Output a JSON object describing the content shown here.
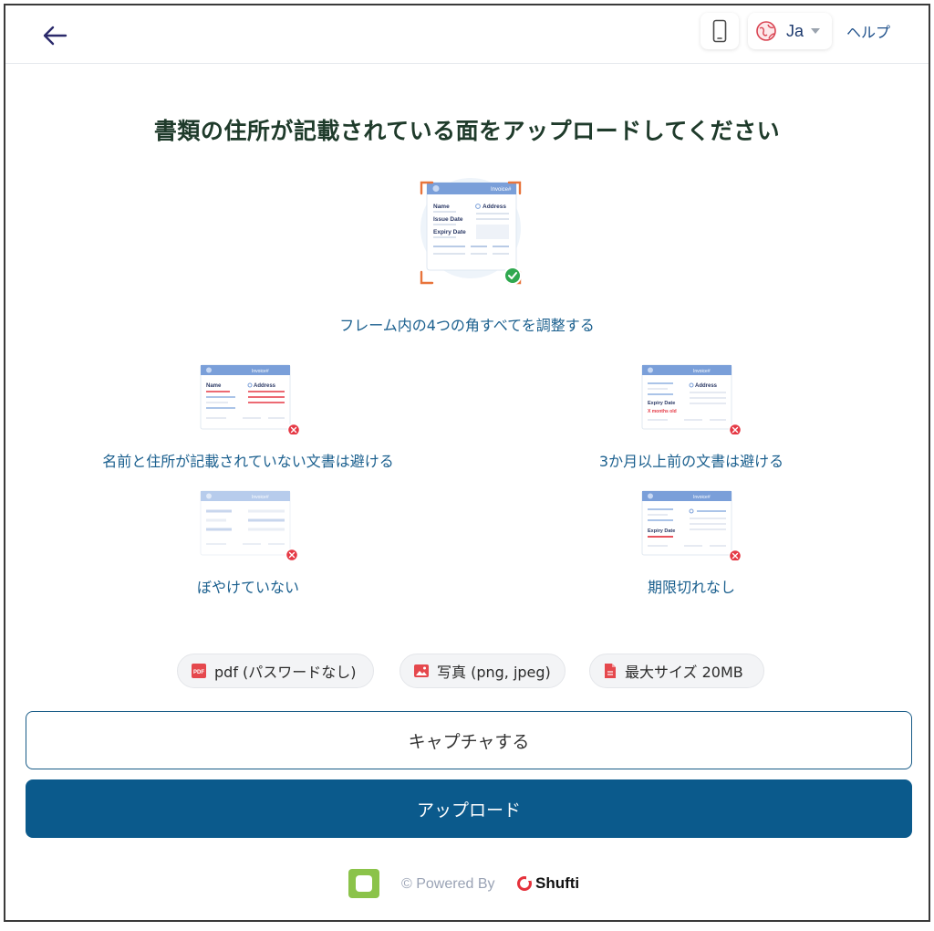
{
  "header": {
    "language_code": "Ja",
    "help_label": "ヘルプ"
  },
  "title": "書類の住所が記載されている面をアップロードしてください",
  "main_instruction": "フレーム内の4つの角すべてを調整する",
  "doc_labels": {
    "brand": "Invoice#",
    "name": "Name",
    "address": "Address",
    "issue_date": "Issue Date",
    "expiry_date": "Expiry Date",
    "months_old": "X months old"
  },
  "rules": [
    {
      "label": "名前と住所が記載されていない文書は避ける"
    },
    {
      "label": "3か月以上前の文書は避ける"
    },
    {
      "label": "ぼやけていない"
    },
    {
      "label": "期限切れなし"
    }
  ],
  "file_chips": [
    {
      "label": "pdf (パスワードなし)",
      "icon": "pdf-icon"
    },
    {
      "label": "写真 (png, jpeg)",
      "icon": "image-icon"
    },
    {
      "label": "最大サイズ 20MB",
      "icon": "file-icon"
    }
  ],
  "buttons": {
    "capture": "キャプチャする",
    "upload": "アップロード"
  },
  "footer": {
    "powered_by": "© Powered By",
    "brand": "Shufti"
  },
  "colors": {
    "primary": "#0b5a8c",
    "title": "#1f3b2b",
    "caption": "#1a5f8e",
    "error": "#e53945",
    "success": "#2fa84f"
  }
}
